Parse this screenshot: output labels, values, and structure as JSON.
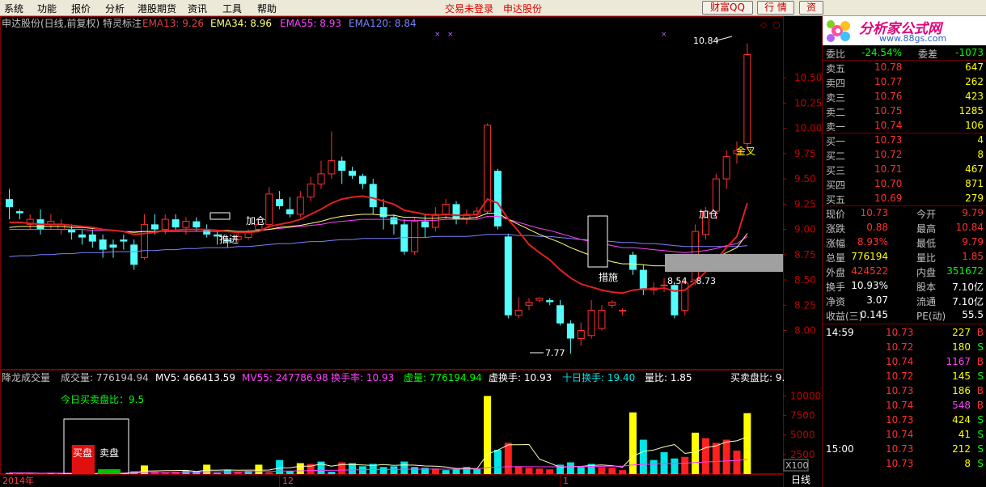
{
  "menu": {
    "items": [
      "系统",
      "功能",
      "报价",
      "分析",
      "港股期货",
      "资讯",
      "工具",
      "帮助"
    ],
    "alert_login": "交易未登录",
    "stock_name": "申达股份",
    "btn_qq": "财富QQ",
    "btn_quote": "行 情",
    "btn_info": "资"
  },
  "header": {
    "title": "申达股份(日线,前复权) 特灵标注",
    "ema13": "EMA13: 9.26",
    "ema34": "EMA34: 8.96",
    "ema55": "EMA55: 8.93",
    "ema120": "EMA120: 8.84",
    "colors": {
      "ema13": "#E04040",
      "ema34": "#FFFF80",
      "ema55": "#FF40FF",
      "ema120": "#8080FF"
    }
  },
  "price_axis": [
    "10.50",
    "10.25",
    "10.00",
    "9.75",
    "9.50",
    "9.25",
    "9.00",
    "8.75",
    "8.50",
    "8.25",
    "8.00"
  ],
  "annotations": {
    "high_label": "10.84",
    "low_label": "7.77",
    "range_label": "8.54 - 8.73",
    "tuijin": "推进",
    "jiacang1": "加仓",
    "jiacang2": "加仓",
    "cuoshi": "措施",
    "jincha": "金叉"
  },
  "volume_header": {
    "title": "降龙成交量",
    "vol": "成交量: 776194.94",
    "mv5": "MV5: 466413.59",
    "mv55": "MV55: 247786.98",
    "turnover": "换手率: 10.93",
    "xuliang": "虚量: 776194.94",
    "xuhuanshou": "虚换手: 10.93",
    "shirihuanshou": "十日换手: 19.40",
    "liangbi": "量比: 1.85",
    "maimaipanbi": "买卖盘比: 9."
  },
  "volume_axis": [
    "10000",
    "7500",
    "5000",
    "2500"
  ],
  "volume_unit": "X100",
  "today_ratio": "今日买卖盘比：9.5",
  "buy_label": "买盘",
  "sell_label": "卖盘",
  "date_axis": [
    "2014年",
    "12",
    "1"
  ],
  "period_label": "日线",
  "panel": {
    "logo_text": "分析家公式网",
    "logo_url": "www.88gs.com",
    "weibi": {
      "label": "委比",
      "value": "-24.54%",
      "label2": "委差",
      "value2": "-1073"
    },
    "asks": [
      {
        "label": "卖五",
        "price": "10.78",
        "vol": "647"
      },
      {
        "label": "卖四",
        "price": "10.77",
        "vol": "262"
      },
      {
        "label": "卖三",
        "price": "10.76",
        "vol": "423"
      },
      {
        "label": "卖二",
        "price": "10.75",
        "vol": "1285"
      },
      {
        "label": "卖一",
        "price": "10.74",
        "vol": "106"
      }
    ],
    "bids": [
      {
        "label": "买一",
        "price": "10.73",
        "vol": "4"
      },
      {
        "label": "买二",
        "price": "10.72",
        "vol": "8"
      },
      {
        "label": "买三",
        "price": "10.71",
        "vol": "467"
      },
      {
        "label": "买四",
        "price": "10.70",
        "vol": "871"
      },
      {
        "label": "买五",
        "price": "10.69",
        "vol": "279"
      }
    ],
    "stats": [
      {
        "l1": "现价",
        "v1": "10.73",
        "l2": "今开",
        "v2": "9.79",
        "c1": "#FF3030",
        "c2": "#FF3030"
      },
      {
        "l1": "涨跌",
        "v1": "0.88",
        "l2": "最高",
        "v2": "10.84",
        "c1": "#FF3030",
        "c2": "#FF3030"
      },
      {
        "l1": "涨幅",
        "v1": "8.93%",
        "l2": "最低",
        "v2": "9.79",
        "c1": "#FF3030",
        "c2": "#FF3030"
      },
      {
        "l1": "总量",
        "v1": "776194",
        "l2": "量比",
        "v2": "1.85",
        "c1": "#FFFF00",
        "c2": "#FF3030"
      },
      {
        "l1": "外盘",
        "v1": "424522",
        "l2": "内盘",
        "v2": "351672",
        "c1": "#FF3030",
        "c2": "#00FF00"
      },
      {
        "l1": "换手",
        "v1": "10.93%",
        "l2": "股本",
        "v2": "7.10亿",
        "c1": "#FFFFFF",
        "c2": "#FFFFFF"
      },
      {
        "l1": "净资",
        "v1": "3.07",
        "l2": "流通",
        "v2": "7.10亿",
        "c1": "#FFFFFF",
        "c2": "#FFFFFF"
      },
      {
        "l1": "收益(三)",
        "v1": "0.145",
        "l2": "PE(动)",
        "v2": "55.5",
        "c1": "#FFFFFF",
        "c2": "#FFFFFF"
      }
    ],
    "ticks": [
      {
        "time": "14:59",
        "price": "10.73",
        "vol": "227",
        "bs": "B",
        "vc": "#FFFF00"
      },
      {
        "time": "",
        "price": "10.72",
        "vol": "180",
        "bs": "S",
        "vc": "#FFFF00"
      },
      {
        "time": "",
        "price": "10.74",
        "vol": "1167",
        "bs": "B",
        "vc": "#FF40FF"
      },
      {
        "time": "",
        "price": "10.72",
        "vol": "145",
        "bs": "S",
        "vc": "#FFFF00"
      },
      {
        "time": "",
        "price": "10.73",
        "vol": "186",
        "bs": "B",
        "vc": "#FFFF00"
      },
      {
        "time": "",
        "price": "10.74",
        "vol": "548",
        "bs": "B",
        "vc": "#FF40FF"
      },
      {
        "time": "",
        "price": "10.73",
        "vol": "424",
        "bs": "S",
        "vc": "#FFFF00"
      },
      {
        "time": "",
        "price": "10.74",
        "vol": "41",
        "bs": "S",
        "vc": "#FFFF00"
      },
      {
        "time": "15:00",
        "price": "10.73",
        "vol": "212",
        "bs": "S",
        "vc": "#FFFF00"
      },
      {
        "time": "",
        "price": "10.73",
        "vol": "8",
        "bs": "S",
        "vc": "#FFFF00"
      }
    ]
  },
  "chart_data": {
    "type": "candlestick",
    "ylim": [
      7.7,
      10.95
    ],
    "candles": [
      [
        9.3,
        9.22,
        9.4,
        9.1
      ],
      [
        9.18,
        9.16,
        9.2,
        9.1
      ],
      [
        9.05,
        9.1,
        9.15,
        9.0
      ],
      [
        9.1,
        9.0,
        9.2,
        8.95
      ],
      [
        9.05,
        9.08,
        9.15,
        9.0
      ],
      [
        9.0,
        9.05,
        9.1,
        8.95
      ],
      [
        9.0,
        8.97,
        9.05,
        8.9
      ],
      [
        8.95,
        8.92,
        9.0,
        8.85
      ],
      [
        8.95,
        8.88,
        9.0,
        8.82
      ],
      [
        8.9,
        8.8,
        8.95,
        8.72
      ],
      [
        8.85,
        8.82,
        8.9,
        8.72
      ],
      [
        8.9,
        8.88,
        8.95,
        8.8
      ],
      [
        8.85,
        8.65,
        8.9,
        8.6
      ],
      [
        8.72,
        9.05,
        9.15,
        8.7
      ],
      [
        9.05,
        9.0,
        9.15,
        8.95
      ],
      [
        9.0,
        9.1,
        9.15,
        8.95
      ],
      [
        9.1,
        9.02,
        9.15,
        8.98
      ],
      [
        9.02,
        9.08,
        9.12,
        8.95
      ],
      [
        9.08,
        9.02,
        9.12,
        8.98
      ],
      [
        9.0,
        8.95,
        9.05,
        8.92
      ],
      [
        8.95,
        8.93,
        8.98,
        8.85
      ],
      [
        8.9,
        8.88,
        8.92,
        8.82
      ],
      [
        8.9,
        8.93,
        8.98,
        8.88
      ],
      [
        8.92,
        8.97,
        9.0,
        8.9
      ],
      [
        9.0,
        9.05,
        9.08,
        8.98
      ],
      [
        9.05,
        9.35,
        9.42,
        9.0
      ],
      [
        9.3,
        9.23,
        9.38,
        9.2
      ],
      [
        9.2,
        9.15,
        9.32,
        9.12
      ],
      [
        9.15,
        9.32,
        9.38,
        9.12
      ],
      [
        9.32,
        9.45,
        9.52,
        9.28
      ],
      [
        9.45,
        9.55,
        9.68,
        9.4
      ],
      [
        9.55,
        9.68,
        9.97,
        9.5
      ],
      [
        9.68,
        9.58,
        9.72,
        9.45
      ],
      [
        9.58,
        9.53,
        9.62,
        9.5
      ],
      [
        9.53,
        9.45,
        9.55,
        9.4
      ],
      [
        9.45,
        9.22,
        9.5,
        9.15
      ],
      [
        9.22,
        9.12,
        9.3,
        9.0
      ],
      [
        9.12,
        9.05,
        9.15,
        8.95
      ],
      [
        9.05,
        8.78,
        9.1,
        8.75
      ],
      [
        8.78,
        9.08,
        9.12,
        8.75
      ],
      [
        9.08,
        9.02,
        9.15,
        8.92
      ],
      [
        9.02,
        9.15,
        9.22,
        8.98
      ],
      [
        9.15,
        9.25,
        9.3,
        9.1
      ],
      [
        9.25,
        9.1,
        9.28,
        9.05
      ],
      [
        9.1,
        9.15,
        9.2,
        9.05
      ],
      [
        9.15,
        9.18,
        9.22,
        9.1
      ],
      [
        9.18,
        10.03,
        10.05,
        9.15
      ],
      [
        9.58,
        9.03,
        9.6,
        9.0
      ],
      [
        8.93,
        8.15,
        8.96,
        8.12
      ],
      [
        8.15,
        8.2,
        8.33,
        8.12
      ],
      [
        8.25,
        8.28,
        8.32,
        8.2
      ],
      [
        8.3,
        8.32,
        8.33,
        8.28
      ],
      [
        8.3,
        8.28,
        8.32,
        8.25
      ],
      [
        8.25,
        8.07,
        8.3,
        8.05
      ],
      [
        8.07,
        7.92,
        8.1,
        7.77
      ],
      [
        7.92,
        8.0,
        8.08,
        7.85
      ],
      [
        7.95,
        8.2,
        8.3,
        7.92
      ],
      [
        8.02,
        8.2,
        8.25,
        8.0
      ],
      [
        8.25,
        8.28,
        8.3,
        8.22
      ],
      [
        8.2,
        8.2,
        8.22,
        8.15
      ],
      [
        8.75,
        8.6,
        8.78,
        8.55
      ],
      [
        8.6,
        8.4,
        8.65,
        8.35
      ],
      [
        8.4,
        8.42,
        8.48,
        8.35
      ],
      [
        8.45,
        8.45,
        8.52,
        8.38
      ],
      [
        8.45,
        8.15,
        8.48,
        8.12
      ],
      [
        8.2,
        8.47,
        8.5,
        8.15
      ],
      [
        8.5,
        8.98,
        9.05,
        8.45
      ],
      [
        8.95,
        9.18,
        9.22,
        8.9
      ],
      [
        9.18,
        9.5,
        9.55,
        9.1
      ],
      [
        9.5,
        9.72,
        9.78,
        9.4
      ],
      [
        9.75,
        9.78,
        9.87,
        9.65
      ],
      [
        9.85,
        10.73,
        10.84,
        9.79
      ]
    ],
    "volume": [
      [
        150,
        "#00E5E5"
      ],
      [
        110,
        "#FF2020"
      ],
      [
        100,
        "#FF2020"
      ],
      [
        70,
        "#FF2020"
      ],
      [
        150,
        "#00E5E5"
      ],
      [
        110,
        "#00E5E5"
      ],
      [
        100,
        "#FF2020"
      ],
      [
        90,
        "#00E5E5"
      ],
      [
        60,
        "#00E5E5"
      ],
      [
        180,
        "#00E5E5"
      ],
      [
        120,
        "#FF2020"
      ],
      [
        150,
        "#00E5E5"
      ],
      [
        350,
        "#00E5E5"
      ],
      [
        1100,
        "#FFFF00"
      ],
      [
        300,
        "#FF2020"
      ],
      [
        250,
        "#FF2020"
      ],
      [
        300,
        "#FF2020"
      ],
      [
        450,
        "#00E5E5"
      ],
      [
        350,
        "#00E5E5"
      ],
      [
        1200,
        "#FFFF00"
      ],
      [
        150,
        "#00E5E5"
      ],
      [
        500,
        "#00E5E5"
      ],
      [
        300,
        "#FF2020"
      ],
      [
        400,
        "#00E5E5"
      ],
      [
        1200,
        "#FFFF00"
      ],
      [
        200,
        "#FF2020"
      ],
      [
        1800,
        "#00E5E5"
      ],
      [
        400,
        "#00E5E5"
      ],
      [
        1400,
        "#FFFF00"
      ],
      [
        1300,
        "#FF2020"
      ],
      [
        1600,
        "#00E5E5"
      ],
      [
        300,
        "#00E5E5"
      ],
      [
        1500,
        "#FF2020"
      ],
      [
        1400,
        "#00E5E5"
      ],
      [
        1000,
        "#00E5E5"
      ],
      [
        1300,
        "#00E5E5"
      ],
      [
        900,
        "#00E5E5"
      ],
      [
        1000,
        "#00E5E5"
      ],
      [
        1600,
        "#00E5E5"
      ],
      [
        900,
        "#00E5E5"
      ],
      [
        800,
        "#00E5E5"
      ],
      [
        700,
        "#FF2020"
      ],
      [
        500,
        "#00E5E5"
      ],
      [
        650,
        "#00E5E5"
      ],
      [
        900,
        "#00E5E5"
      ],
      [
        700,
        "#00E5E5"
      ],
      [
        10000,
        "#FFFF00"
      ],
      [
        3100,
        "#00E5E5"
      ],
      [
        4000,
        "#FF2020"
      ],
      [
        1000,
        "#FF2020"
      ],
      [
        800,
        "#FF2020"
      ],
      [
        700,
        "#FF2020"
      ],
      [
        600,
        "#FF2020"
      ],
      [
        1200,
        "#00E5E5"
      ],
      [
        1500,
        "#00E5E5"
      ],
      [
        900,
        "#00E5E5"
      ],
      [
        1300,
        "#00E5E5"
      ],
      [
        900,
        "#FF2020"
      ],
      [
        800,
        "#FF2020"
      ],
      [
        500,
        "#FF2020"
      ],
      [
        7900,
        "#FFFF00"
      ],
      [
        4400,
        "#00E5E5"
      ],
      [
        1800,
        "#00E5E5"
      ],
      [
        2800,
        "#00E5E5"
      ],
      [
        2000,
        "#00E5E5"
      ],
      [
        2200,
        "#FF2020"
      ],
      [
        5300,
        "#FFFF00"
      ],
      [
        4600,
        "#FF2020"
      ],
      [
        4000,
        "#FF2020"
      ],
      [
        4400,
        "#FF2020"
      ],
      [
        3000,
        "#FF2020"
      ],
      [
        7800,
        "#FFFF00"
      ]
    ],
    "ema13": [
      9.07,
      9.07,
      9.06,
      9.05,
      9.05,
      9.05,
      9.04,
      9.03,
      9.02,
      9.0,
      8.99,
      8.98,
      8.95,
      8.96,
      8.97,
      8.99,
      8.99,
      9.0,
      9.0,
      9.0,
      8.99,
      8.98,
      8.97,
      8.97,
      8.98,
      9.03,
      9.05,
      9.07,
      9.1,
      9.15,
      9.2,
      9.26,
      9.3,
      9.32,
      9.33,
      9.31,
      9.28,
      9.25,
      9.19,
      9.17,
      9.15,
      9.14,
      9.15,
      9.14,
      9.14,
      9.15,
      9.3,
      9.26,
      9.1,
      8.98,
      8.85,
      8.77,
      8.7,
      8.6,
      8.52,
      8.46,
      8.43,
      8.4,
      8.38,
      8.37,
      8.4,
      8.41,
      8.41,
      8.42,
      8.39,
      8.4,
      8.48,
      8.58,
      8.7,
      8.82,
      8.93,
      9.26
    ],
    "ema34": [
      9.02,
      9.03,
      9.03,
      9.03,
      9.03,
      9.03,
      9.02,
      9.02,
      9.01,
      9.0,
      8.99,
      8.98,
      8.97,
      8.98,
      8.98,
      8.99,
      8.99,
      9.0,
      9.0,
      9.0,
      8.99,
      8.99,
      8.98,
      8.98,
      8.99,
      9.0,
      9.02,
      9.03,
      9.04,
      9.06,
      9.08,
      9.11,
      9.13,
      9.14,
      9.15,
      9.15,
      9.14,
      9.14,
      9.12,
      9.12,
      9.11,
      9.11,
      9.12,
      9.11,
      9.11,
      9.12,
      9.16,
      9.16,
      9.1,
      9.05,
      9.0,
      8.95,
      8.91,
      8.87,
      8.82,
      8.78,
      8.74,
      8.71,
      8.68,
      8.66,
      8.66,
      8.65,
      8.64,
      8.64,
      8.62,
      8.62,
      8.64,
      8.67,
      8.72,
      8.77,
      8.82,
      8.96
    ],
    "ema55": [
      9.0,
      9.0,
      9.0,
      9.0,
      9.0,
      9.0,
      9.0,
      9.0,
      8.99,
      8.99,
      8.99,
      8.98,
      8.98,
      8.98,
      8.98,
      8.98,
      8.98,
      8.98,
      8.98,
      8.98,
      8.98,
      8.98,
      8.98,
      8.98,
      8.99,
      9.0,
      9.01,
      9.02,
      9.03,
      9.04,
      9.05,
      9.07,
      9.08,
      9.09,
      9.1,
      9.1,
      9.1,
      9.1,
      9.09,
      9.09,
      9.09,
      9.09,
      9.1,
      9.1,
      9.1,
      9.1,
      9.13,
      9.13,
      9.1,
      9.07,
      9.04,
      9.01,
      8.99,
      8.96,
      8.93,
      8.9,
      8.88,
      8.86,
      8.84,
      8.82,
      8.82,
      8.81,
      8.8,
      8.79,
      8.78,
      8.77,
      8.78,
      8.79,
      8.81,
      8.84,
      8.86,
      8.93
    ],
    "ema120": [
      8.73,
      8.74,
      8.74,
      8.75,
      8.75,
      8.76,
      8.76,
      8.77,
      8.77,
      8.77,
      8.78,
      8.78,
      8.78,
      8.79,
      8.79,
      8.8,
      8.8,
      8.81,
      8.81,
      8.82,
      8.82,
      8.82,
      8.83,
      8.83,
      8.84,
      8.85,
      8.86,
      8.86,
      8.87,
      8.88,
      8.88,
      8.89,
      8.9,
      8.9,
      8.91,
      8.91,
      8.91,
      8.91,
      8.92,
      8.92,
      8.92,
      8.93,
      8.93,
      8.93,
      8.93,
      8.94,
      8.95,
      8.95,
      8.95,
      8.94,
      8.94,
      8.93,
      8.93,
      8.92,
      8.91,
      8.9,
      8.9,
      8.89,
      8.88,
      8.87,
      8.87,
      8.86,
      8.86,
      8.85,
      8.84,
      8.83,
      8.83,
      8.83,
      8.83,
      8.83,
      8.83,
      8.84
    ],
    "vol_ylim": [
      0,
      11500
    ]
  }
}
